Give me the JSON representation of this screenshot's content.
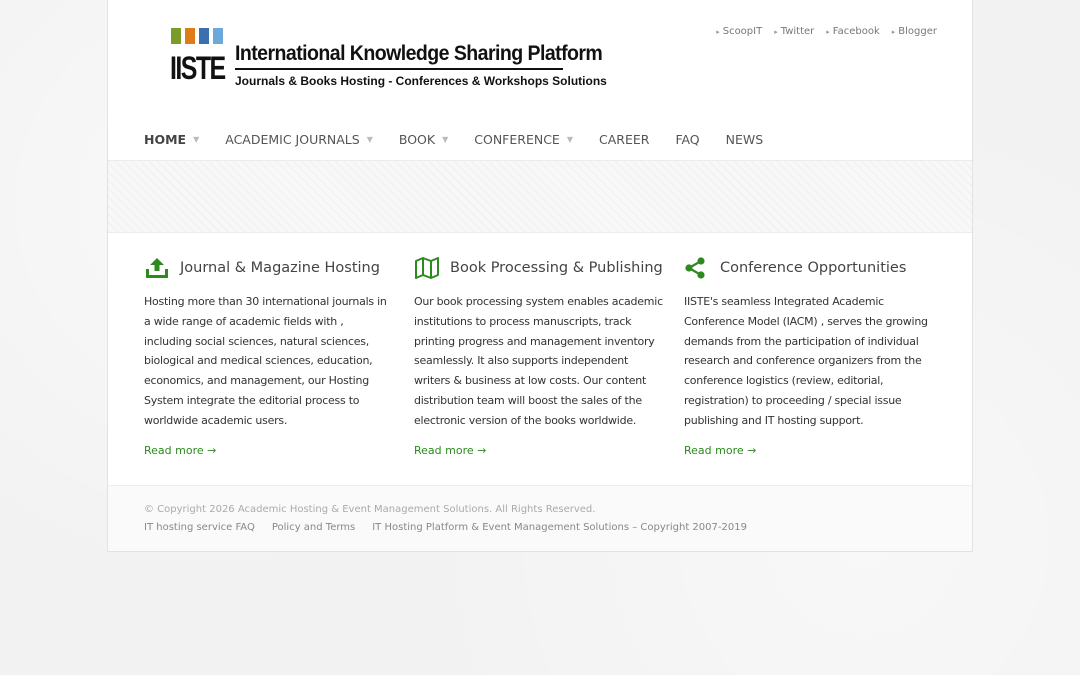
{
  "header": {
    "logo_word": "IISTE",
    "logo_title": "International Knowledge Sharing Platform",
    "logo_subtitle": "Journals & Books Hosting - Conferences & Workshops Solutions",
    "logo_bar_colors": [
      "#7a9a2a",
      "#e07b1a",
      "#3a6fb0",
      "#6aa9d8"
    ],
    "social_links": [
      "ScoopIT",
      "Twitter",
      "Facebook",
      "Blogger"
    ]
  },
  "nav": {
    "items": [
      {
        "label": "HOME",
        "has_dropdown": true,
        "active": true
      },
      {
        "label": "ACADEMIC JOURNALS",
        "has_dropdown": true
      },
      {
        "label": "BOOK",
        "has_dropdown": true
      },
      {
        "label": "CONFERENCE",
        "has_dropdown": true
      },
      {
        "label": "CAREER",
        "has_dropdown": false
      },
      {
        "label": "FAQ",
        "has_dropdown": false
      },
      {
        "label": "NEWS",
        "has_dropdown": false
      }
    ],
    "caret_glyph": "▼"
  },
  "features": [
    {
      "icon": "upload-icon",
      "title": "Journal & Magazine Hosting",
      "text": "Hosting more than 30 international journals in a wide range of academic fields with , including social sciences, natural sciences, biological and medical sciences, education, economics, and management, our Hosting System integrate the editorial process to worldwide academic users.",
      "link": "Read more →"
    },
    {
      "icon": "map-icon",
      "title": "Book Processing & Publishing",
      "text": "Our book processing system enables academic institutions to process manuscripts, track printing progress and management inventory seamlessly. It also supports independent writers & business at low costs. Our content distribution team will boost the sales of the electronic version of the books worldwide.",
      "link": "Read more →"
    },
    {
      "icon": "share-icon",
      "title": "Conference Opportunities",
      "text": "IISTE's seamless Integrated Academic Conference Model (IACM) , serves the growing demands from the participation of individual research and conference organizers from the conference logistics (review, editorial, registration) to proceeding / special issue publishing and IT hosting support.",
      "link": "Read more →"
    }
  ],
  "footer": {
    "copyright": "© Copyright 2026 Academic Hosting & Event Management Solutions. All Rights Reserved.",
    "links": [
      "IT hosting service FAQ",
      "Policy and Terms",
      "IT Hosting Platform & Event Management Solutions – Copyright 2007-2019"
    ]
  },
  "colors": {
    "accent_green": "#2c8a1e",
    "background": "#f2f2f2"
  }
}
